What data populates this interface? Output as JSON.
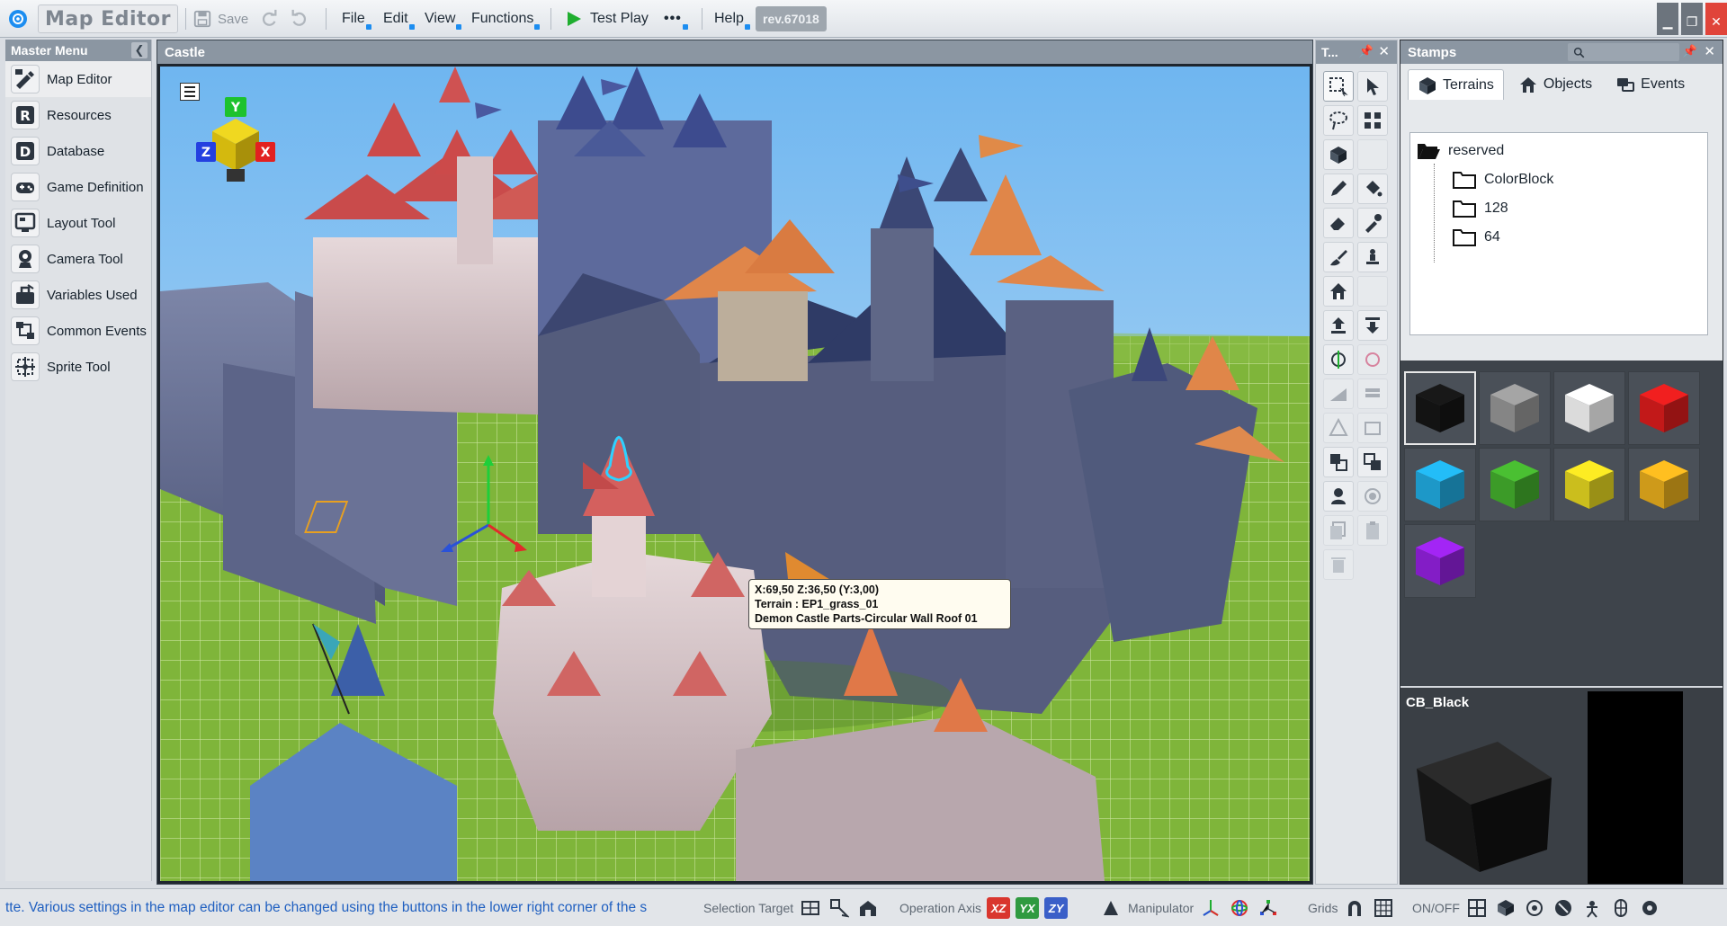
{
  "app": {
    "name": "Map Editor",
    "revision": "rev.67018"
  },
  "toolbar": {
    "save_label": "Save",
    "menus": [
      "File",
      "Edit",
      "View",
      "Functions"
    ],
    "test_play_label": "Test Play",
    "more_label": "•••",
    "help_label": "Help"
  },
  "master_menu": {
    "title": "Master Menu",
    "items": [
      {
        "label": "Map Editor",
        "icon": "map-editor-icon"
      },
      {
        "label": "Resources",
        "icon": "resources-icon"
      },
      {
        "label": "Database",
        "icon": "database-icon"
      },
      {
        "label": "Game Definition",
        "icon": "game-definition-icon"
      },
      {
        "label": "Layout Tool",
        "icon": "layout-tool-icon"
      },
      {
        "label": "Camera Tool",
        "icon": "camera-tool-icon"
      },
      {
        "label": "Variables Used",
        "icon": "variables-icon"
      },
      {
        "label": "Common Events",
        "icon": "common-events-icon"
      },
      {
        "label": "Sprite Tool",
        "icon": "sprite-tool-icon"
      }
    ]
  },
  "viewport": {
    "title": "Castle",
    "tooltip": {
      "coords": "X:69,50 Z:36,50 (Y:3,00)",
      "terrain": "Terrain : EP1_grass_01",
      "object": "Demon Castle Parts-Circular Wall Roof 01"
    },
    "axis_labels": {
      "x": "X",
      "y": "Y",
      "z": "Z"
    }
  },
  "tools_panel": {
    "title": "T...",
    "pin": "📌",
    "close": "✕"
  },
  "stamps": {
    "title": "Stamps",
    "pin": "📌",
    "close": "✕",
    "tabs": [
      {
        "label": "Terrains",
        "icon": "terrain-cube-icon"
      },
      {
        "label": "Objects",
        "icon": "house-icon"
      },
      {
        "label": "Events",
        "icon": "events-icon"
      }
    ],
    "tree": {
      "root": "reserved",
      "children": [
        "ColorBlock",
        "128",
        "64"
      ]
    },
    "swatches": [
      "#141414",
      "#8c8c8c",
      "#e6e6e6",
      "#cc1a1a",
      "#1ea0d2",
      "#3fa32a",
      "#d6c81e",
      "#d9a21b",
      "#8a1fd0"
    ],
    "preview_label": "CB_Black"
  },
  "statusbar": {
    "message": "tte.  Various settings in the map editor can be changed using the buttons in the lower right corner of the s",
    "selection_target": "Selection Target",
    "operation_axis": "Operation Axis",
    "axis_buttons": [
      {
        "label": "XZ",
        "color": "#d9362e"
      },
      {
        "label": "YX",
        "color": "#2f9a40"
      },
      {
        "label": "ZY",
        "color": "#3a5fc8"
      }
    ],
    "manipulator": "Manipulator",
    "grids": "Grids",
    "on_off": "ON/OFF"
  }
}
